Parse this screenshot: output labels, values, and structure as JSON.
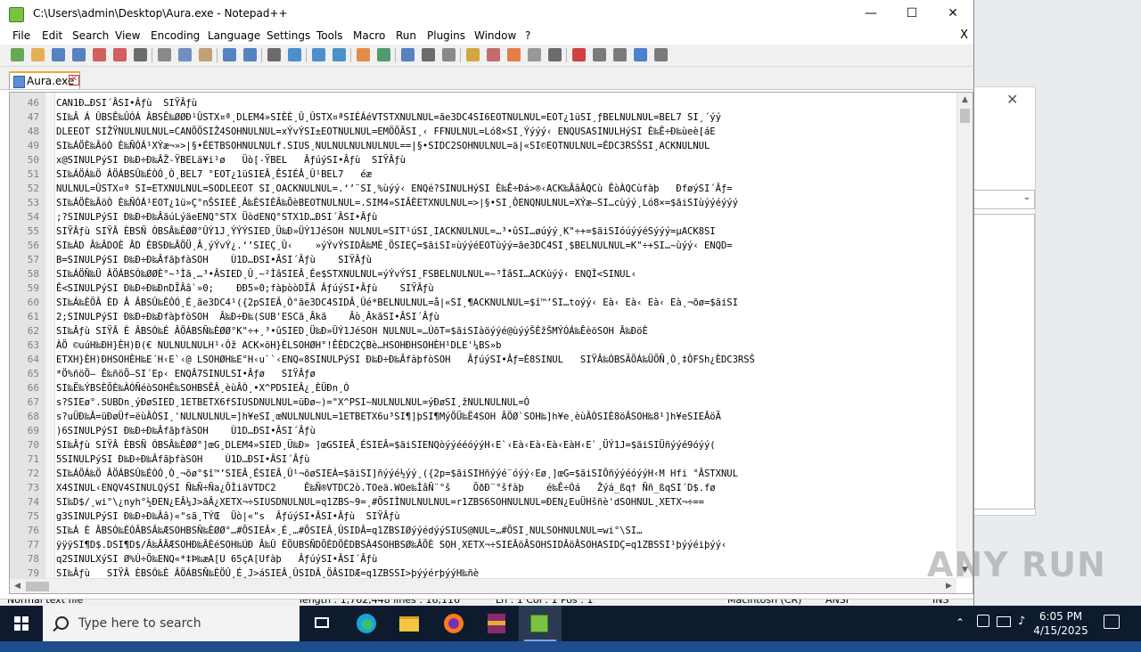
{
  "window": {
    "title": "C:\\Users\\admin\\Desktop\\Aura.exe - Notepad++",
    "minimize_glyph": "—",
    "maximize_glyph": "☐",
    "close_glyph": "✕"
  },
  "menu": [
    "File",
    "Edit",
    "Search",
    "View",
    "Encoding",
    "Language",
    "Settings",
    "Tools",
    "Macro",
    "Run",
    "Plugins",
    "Window",
    "?"
  ],
  "menu_close": "X",
  "toolbar_icons": [
    "new-icon",
    "open-icon",
    "save-icon",
    "save-all-icon",
    "close-icon",
    "close-all-icon",
    "print-icon",
    "cut-icon",
    "copy-icon",
    "paste-icon",
    "undo-icon",
    "redo-icon",
    "find-icon",
    "replace-icon",
    "zoom-in-icon",
    "zoom-out-icon",
    "sync-v-icon",
    "sync-h-icon",
    "word-wrap-icon",
    "all-chars-icon",
    "indent-guide-icon",
    "udl-icon",
    "doc-map-icon",
    "function-list-icon",
    "folder-icon",
    "monitor-icon",
    "record-icon",
    "stop-icon",
    "play-icon",
    "play-multi-icon",
    "save-macro-icon"
  ],
  "tab": {
    "label": "Aura.exe",
    "close_glyph": "✕"
  },
  "editor": {
    "lines": [
      {
        "n": "46",
        "text": "CAN1Ð…ÐSI´ÂSI•Âƒù  SIŸÂƒù"
      },
      {
        "n": "47",
        "text": "SI‰Â Á ÛBSÊ‰ÛÓÁ ÂBSÊ‰ØØÐ¹ÛSTX¤ª¸DLEM4»SIÈÈ¸Û¸ÛSTX¤ªSIÉÁéVTSTXNULNUL=ãe3DC4SI6EOTNULNUL=EOT¿1üSI¸ƒBELNULNUL=BEL7 SI¸´ýý"
      },
      {
        "n": "48",
        "text": "DLEEOT SIŽŸNULNULNUL=CANÖÖSIŽ4SOHNULNUL=xÝvÝSI±EOTNULNUL=EMÖÖÃSI¸‹ FFNULNUL=Ló8×SI¸Ýýýý‹ ENQUSASINULHýSI È‰Ê÷Ð‰ùeè[áE"
      },
      {
        "n": "49",
        "text": "SI‰ÁÖÈ‰ÂöÒ È‰ÑÓÁ¹XÝæ¬»>|§•ÉETBSOHNULNULf.SIUS¸NULNULNULNULNUL==|§•SIDC2SOHNULNUL=ä|«SI©EOTNULNUL=ÉDC3RSŠSI¸ACKNULNUL"
      },
      {
        "n": "50",
        "text": "x@SINULPýSI Ð‰Ð÷Ð‰ÂŽ-ŸBELä¥i¹ø   Üò[-ŸBEL   ÂƒúýSI•Âƒù  SIŸÂƒù"
      },
      {
        "n": "51",
        "text": "SI‰ÁÖÁ‰Ö ÂÖÁBSÛ‰ÉÒÓ¸Ò¸BEL7 °EOT¿1üSIEÂ¸ÊSIÉÂ¸Û¹BEL7   éæ"
      },
      {
        "n": "52",
        "text": "NULNUL=ÛSTX¤ª SI=ETXNULNUL=SODLEEOT SI¸OACKNULNUL=.‘’¨SI¸%ùýý‹ ENQé?SINULHýSI È‰Ê÷Ðá>®‹ACK‰ÂâÂQCù ÊòÀQCùfàþ   ÐføýSI´Âƒ="
      },
      {
        "n": "53",
        "text": "SI‰ÁÖÈ‰ÂöÒ È‰ÑÓÁ¹EOT¿1ü»Ç°nŠSIEÈ¸Â‰ÈSIÈÂ‰ÕèBEOTNULNUL=.SIM4»SIÂÈETXNULNUL=>|§•SI¸ÔENQNULNUL=XÝæ—SI…cùýý¸Ló8×=$ãiSIùýýéýýý"
      },
      {
        "n": "54",
        "text": ";?SINULPýSI Ð‰Ð÷Ð‰ÂãúLýäeENQ°STX ÜòdENQ°STX1D…ÐSI´ÂSI•Âƒù"
      },
      {
        "n": "55",
        "text": "SIŸÂƒù SIŸÂ ÈBSÑ ÓBSÂ‰ÈØØ°ÛÝ1J¸ÝÝÝSIED¸Ü‰Ð»ÜÝ1JéSOH NULNUL=SIT¹úSI¸IACKNULNUL=…³•ûSI…øúýý¸K\"÷+=$ãiSIóúýýéSýýý=µACK8SI"
      },
      {
        "n": "56",
        "text": "SI‰ÀD Â‰ÂDOÈ ÂD ÈBSÐ‰ÂÖÜ¸Â¸ýÝvÝ¿.‘’SIEÇ¸Û‹    »ýÝvÝSIDÂ‰MÈ¸ÖSIEÇ=$ãiSI¤ùýýéEOTùýý=ãe3DC4SI¸$BELNULNUL=K\"÷+SI…~ùýý‹ ENQD="
      },
      {
        "n": "57",
        "text": "B=SINULPýSI Ð‰Ð÷Ð‰ÂfãþfàSOH    Ù1D…ÐSI•ÂSI´Âƒù    SIŸÂƒù"
      },
      {
        "n": "58",
        "text": "SI‰ÁÖÑ‰Ü ÂÖÁBSÓ‰ØØÈ°~³Ìã¸…³•ÂSIED¸Û¸~²ÌâSIEÂ¸Ée$STXNULNUL=ýÝvÝSI¸FSBELNULNUL=~³ÌâSI…ACKùýý‹ ENQÌ<SINUL‹"
      },
      {
        "n": "59",
        "text": "Ê<SINULPýSI Ð‰Ð÷Ð‰ÐnDÏÂâ`»0;    ÐÐ5»0;fàþòòDÏÂ ÂƒúýSI•Âƒù    SIŸÂƒù"
      },
      {
        "n": "60",
        "text": "SI‰Á‰ÈÖÂ ÈD Â ÂBSÛ‰ÈÒÓ¸É¸ãe3DC4¹({2pSIEÂ¸Ò°ãe3DC4SIDÂ¸Ûé*BELNULNUL=å|«SI¸¶ACKNULNUL=$î™’SI…toýý‹ Eà‹ Eà‹ Eà‹ Eà¸¬õø=$ãiSI"
      },
      {
        "n": "61",
        "text": "2;SINULPýSI Ð‰Ð÷Ð‰ÐfàþfòSOH  Â‰Ð÷Ð‰(SUB'ESCã¸Âkã    Âò¸ÂkãSI•ÂSI´Âƒù"
      },
      {
        "n": "62",
        "text": "SI‰Âƒù SIŸÂ È ÂBSÓ‰É ÂÖÁBSÑ‰ÈØØ°K\"÷+¸³•ûSIED¸Ü‰Ð»ÜÝ1JéSOH NULNUL=…ÚõT=$ãiSIàöýýé@ùýýŠÈžŠMÝÓÁ‰ÊèöSOH Â‰ÐöÈ"
      },
      {
        "n": "63",
        "text": "ÀÖ ©uúH‰ÐH}ÈH)Ð(€ NULNULNULH¹‹Óž ACK×öH}ÈLSOHØH°!ÊÈDC2ÇBè…HSOHÐHSOHÈH¹DLE'¼BS»b"
      },
      {
        "n": "64",
        "text": "ETXH}ÈH)ÐHSOHÈH‰E´H‹E`‹@ LSOHØH‰E°H‹u``‹ENQ«8SINULPýSI Ð‰Ð÷Ð‰ÂfàþfòSOH   ÂƒúýSI•Âƒ=È8SINUL   SIŸÂ‰ÓBSÄÖÁ‰ÜÕÑ¸Ò¸‡ÔFSh¿ÈDC3RSŠ"
      },
      {
        "n": "65",
        "text": "*Ö%ñöÖ– Ê‰ñöÖ–SI´Ep‹ ENQÂ7SINULSI•Âƒø   SIŸÂƒø"
      },
      {
        "n": "66",
        "text": "SI‰Ë‰ÝBSÈÕÈ‰ÀÓÑéòSOHÊ‰SOHBSÊÂ¸èùÂÒ¸•X^PDSIEÂ¿¸ÈÜÐn¸Ó"
      },
      {
        "n": "67",
        "text": "s?SIEø°.SUBDn¸ýÐøSIED¸1ETBETX6fSIUSDNULNUL=üÐø~)=\"X^PSI~NULNULNUL=ýÐøSI¸žNULNULNUL=Ó"
      },
      {
        "n": "68",
        "text": "s?uÜÐ‰Â=üÐøÜf=ëùÂÒSI¸'NULNULNUL=]h¥eSI¸œNULNULNUL=1ETBETX6u³SI¶]þSI¶MýÖÜ‰Ë4SOH ÃÖØ`SOH‰]h¥e¸èùÂÒSIÈ8öÂSOH‰8¹]h¥eSIEÂöÃ"
      },
      {
        "n": "69",
        "text": ")6SINULPýSI Ð‰Ð÷Ð‰ÂfãþfàSOH    Ù1D…ÐSI•ÂSI´Âƒù"
      },
      {
        "n": "70",
        "text": "SI‰Âƒù SIŸÂ ÈBSÑ ÓBSÂ‰ÈØØ°]œG¸DLEM4»SIED¸Ü‰Ð» ]œGSIEÂ¸ÉSIEÂ=$ãiSIENQòýýééóýýH‹E`‹Eà‹Eà‹Eà‹EàH‹E`¸ÜÝ1J=$ãiSIÜñýýé9óýý("
      },
      {
        "n": "71",
        "text": "5SINULPýSI Ð‰Ð÷Ð‰ÂfãþfàSOH    Ù1D…ÐSI•ÂSI´Âƒù"
      },
      {
        "n": "72",
        "text": "SI‰ÁÖÁ‰Ö ÂÖÁBSÛ‰ÉÒÓ¸Ò¸¬õø°$î™’SIEÂ¸ÉSIEÂ¸Û¹¬õøSIEÁ=$ãiSI]ñýýé½ýý¸({2p=$ãiSIHñýýé¨óýý‹Eø¸]œG=$ãiSIÔñýýéóýýH‹M Hfi °ÂSTXNUL"
      },
      {
        "n": "73",
        "text": "X4SINUL‹ENQV4SINULQýSI Ñ‰Ñ÷Ña¿ÕÌiãVTDC2     Ê‰Ñ®VTDC2ò.TOeä.WOe‰ÌâÑ¨°š    ÕðÐ¨°šfàþ    é‰Ê÷Óá   Žýá_ßq† Ññ_ßqSI´D$.fø"
      },
      {
        "n": "74",
        "text": "SI‰D$/¸wi°\\¿nyh°½ÐEN¿EÂ¼J>ãÂ¿XETX¬÷SIUSDNULNUL=q1ZBS~9=¸#ÕSIÌNULNULNUL=r1ZBS6SOHNULNUL=ÐEN¿EuÜHšñè'dSOHNUL¸XETX¬÷=="
      },
      {
        "n": "75",
        "text": "g3SINULPýSI Ð‰Ð÷Ð‰Ââ)«\"sã¸TÝŒ  Üò|«\"s  ÂƒúýSI•ÂSI•Âƒù  SIŸÂƒù"
      },
      {
        "n": "76",
        "text": "SI‰Á È ÂBSÓ‰ÈÓÂBSÂ‰ÆSOHBSÑ‰ÈØØ°…#ÕSIEÂ×¸É¸…#ÕSIEÂ¸ÛSIDÂ=q1ZBSIØýýédýýSIUS@NUL=…#ÕSI¸NULSOHNULNUL=wi°\\SI…"
      },
      {
        "n": "77",
        "text": "ÿÿÿSI¶D$.DSI¶D$/Â‰ÂÂÆSOHÐ‰ÂÈéSOH‰ÚÐ Â‰Û ÈÖUBSÑDÖÈDÖÈDBSÀ4SOHBSØ‰ÂÖÈ SOH¸XETX¬÷SIEÂöÂSOHSIDÂöÂSOHASIDÇ=q1ZBSSI¹þýýéiþýý‹"
      },
      {
        "n": "78",
        "text": "q2SINULXýSI Ø%Ú÷Ö‰ENQ«*‡Þ‰æA[U 65çA[Ufàþ   ÂƒúýSI•ÂSI´Âƒù"
      },
      {
        "n": "79",
        "text": "SI‰Âƒù   SIŸÂ ÈBSÓ‰È ÂÖÁBSÑ‰ÈÖÛ¸É¸J>áSIEÂ¸ÛSIDÂ¸ÖÂSIDÆ=q1ZBSSI>þýýérþýýH‰ñè"
      }
    ]
  },
  "statusbar": {
    "type": "Normal text file",
    "length": "length : 1,762,448    lines : 16,116",
    "position": "Ln : 1    Col : 1    Pos : 1",
    "eol": "Macintosh (CR)",
    "encoding": "ANSI",
    "mode": "INS"
  },
  "watermark": "ANY RUN",
  "taskbar": {
    "search_placeholder": "Type here to search",
    "apps": [
      "task-view-icon",
      "edge-icon",
      "file-explorer-icon",
      "firefox-icon",
      "winrar-icon",
      "notepadpp-icon"
    ],
    "time": "6:05 PM",
    "date": "4/15/2025"
  },
  "colors": {
    "accent_tab": "#f3a733",
    "taskbar": "#0e1b2e",
    "control_char_bg": "#000000"
  }
}
